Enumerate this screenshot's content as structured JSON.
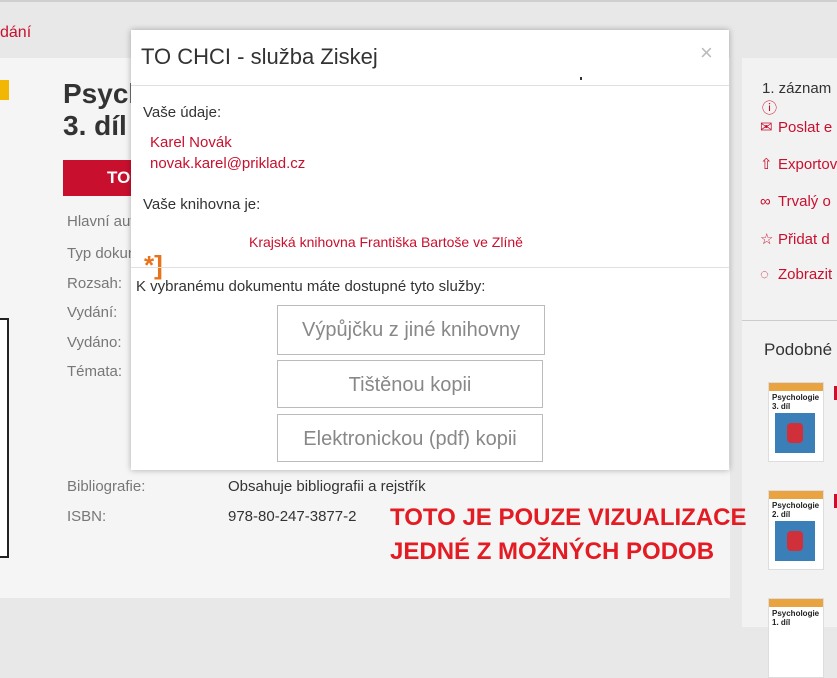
{
  "background": {
    "breadcrumb": "dání",
    "book_title_line1": "Psych",
    "book_title_line2": "3. díl",
    "action_button": "TO",
    "fields": [
      {
        "label": "Hlavní aut",
        "value": ""
      },
      {
        "label": "Typ dokum",
        "value": ""
      },
      {
        "label": "Rozsah:",
        "value": ""
      },
      {
        "label": "Vydání:",
        "value": ""
      },
      {
        "label": "Vydáno:",
        "value": ""
      },
      {
        "label": "Témata:",
        "value": ""
      },
      {
        "label": "Bibliografie:",
        "value": "Obsahuje bibliografii a rejstřík"
      },
      {
        "label": "ISBN:",
        "value": "978-80-247-3877-2"
      }
    ],
    "sidebar": {
      "count": "1. záznam",
      "items": [
        {
          "icon": "envelope-icon",
          "label": "Poslat e"
        },
        {
          "icon": "export-icon",
          "label": "Exportov"
        },
        {
          "icon": "link-icon",
          "label": "Trvalý o"
        },
        {
          "icon": "star-icon",
          "label": "Přidat d"
        },
        {
          "icon": "comment-icon",
          "label": "Zobrazit"
        }
      ],
      "similar_title": "Podobné",
      "thumbnails": [
        {
          "title": "Psychologie 3. díl"
        },
        {
          "title": "Psychologie 2. díl"
        },
        {
          "title": "Psychologie 1. díl"
        }
      ]
    },
    "overlay_line1": "TOTO JE POUZE VIZUALIZACE",
    "overlay_line2": "JEDNÉ Z MOŽNÝCH PODOB"
  },
  "modal": {
    "title": "TO CHCI - služba Ziskej",
    "close": "×",
    "user_label": "Vaše údaje:",
    "user_name": "Karel Novák",
    "user_email": "novak.karel@priklad.cz",
    "library_label": "Vaše knihovna je:",
    "library_logo": "*]",
    "library_name": "Krajská knihovna Františka Bartoše ve Zlíně",
    "services_label": "K vybranému dokumentu máte dostupné tyto služby:",
    "services": [
      "Výpůjčku z jiné knihovny",
      "Tištěnou kopii",
      "Elektronickou (pdf) kopii"
    ]
  },
  "colors": {
    "accent": "#c8102e",
    "logo": "#e8731a",
    "overlay_text": "#e31b23"
  }
}
